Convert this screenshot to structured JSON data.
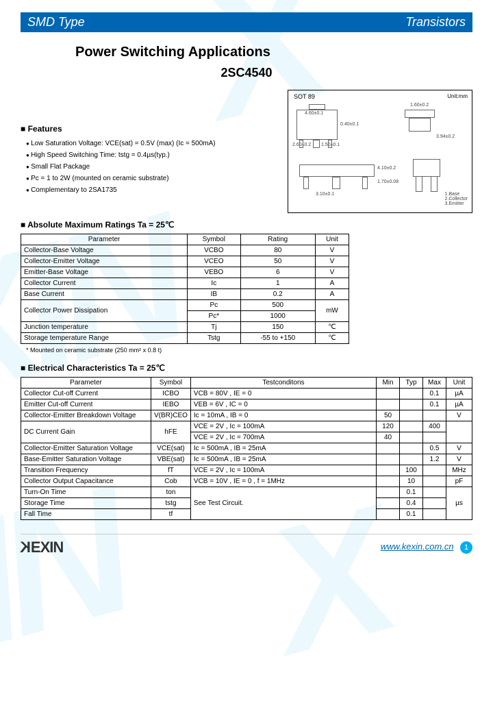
{
  "header": {
    "left": "SMD Type",
    "right": "Transistors"
  },
  "title1": "Power Switching Applications",
  "title2": "2SC4540",
  "features": {
    "heading": "Features",
    "items": [
      "Low Saturation Voltage: VCE(sat) = 0.5V (max) (Ic = 500mA)",
      "High Speed Switching Time: tstg = 0.4µs(typ.)",
      "Small Flat Package",
      "Pc = 1 to 2W (mounted on ceramic substrate)",
      "Complementary to 2SA1735"
    ]
  },
  "diagram": {
    "pkg": "SOT 89",
    "unit": "Unit:mm",
    "d1": "4.60±0.1",
    "d2": "1.50±0.1",
    "d3": "2.60±0.2",
    "d4": "0.40±0.1",
    "d5": "1.70±0.08",
    "d6": "4.10±0.2",
    "d7": "3.10±0.1",
    "d8": "0.40±0.1",
    "d9": "1.60±0.2",
    "d10": "3.94±0.2",
    "pins": "1.Base\n2.Collector\n3.Emitter"
  },
  "amr": {
    "heading": "Absolute Maximum Ratings Ta = 25℃",
    "head": [
      "Parameter",
      "Symbol",
      "Rating",
      "Unit"
    ],
    "rows": [
      [
        "Collector-Base Voltage",
        "VCBO",
        "80",
        "V"
      ],
      [
        "Collector-Emitter Voltage",
        "VCEO",
        "50",
        "V"
      ],
      [
        "Emitter-Base Voltage",
        "VEBO",
        "6",
        "V"
      ],
      [
        "Collector Current",
        "Ic",
        "1",
        "A"
      ],
      [
        "Base Current",
        "IB",
        "0.2",
        "A"
      ]
    ],
    "pdiss": {
      "param": "Collector Power Dissipation",
      "s1": "Pc",
      "v1": "500",
      "s2": "Pc*",
      "v2": "1000",
      "unit": "mW"
    },
    "rows2": [
      [
        "Junction temperature",
        "Tj",
        "150",
        "℃"
      ],
      [
        "Storage temperature Range",
        "Tstg",
        "-55 to +150",
        "℃"
      ]
    ],
    "note": "* Mounted on ceramic substrate (250 mm² x 0.8 t)"
  },
  "ec": {
    "heading": "Electrical Characteristics Ta = 25℃",
    "head": [
      "Parameter",
      "Symbol",
      "Testconditons",
      "Min",
      "Typ",
      "Max",
      "Unit"
    ],
    "rows": [
      [
        "Collector Cut-off Current",
        "ICBO",
        "VCB = 80V , IE = 0",
        "",
        "",
        "0.1",
        "µA"
      ],
      [
        "Emitter Cut-off Current",
        "IEBO",
        "VEB = 6V , IC = 0",
        "",
        "",
        "0.1",
        "µA"
      ],
      [
        "Collector-Emitter Breakdown Voltage",
        "V(BR)CEO",
        "Ic = 10mA , IB = 0",
        "50",
        "",
        "",
        "V"
      ]
    ],
    "dcgain": {
      "param": "DC Current Gain",
      "sym": "hFE",
      "c1": "VCE = 2V , Ic = 100mA",
      "mn1": "120",
      "mx1": "400",
      "c2": "VCE = 2V , Ic = 700mA",
      "mn2": "40"
    },
    "rows2": [
      [
        "Collector-Emitter Saturation Voltage",
        "VCE(sat)",
        "Ic = 500mA , IB = 25mA",
        "",
        "",
        "0.5",
        "V"
      ],
      [
        "Base-Emitter Saturation Voltage",
        "VBE(sat)",
        "Ic = 500mA , IB = 25mA",
        "",
        "",
        "1.2",
        "V"
      ],
      [
        "Transition Frequency",
        "fT",
        "VCE = 2V , Ic = 100mA",
        "",
        "100",
        "",
        "MHz"
      ],
      [
        "Collector Output Capacitance",
        "Cob",
        "VCB = 10V , IE = 0 , f = 1MHz",
        "",
        "10",
        "",
        "pF"
      ]
    ],
    "sw": {
      "cond": "See Test Circuit.",
      "unit": "µs",
      "r": [
        [
          "Turn-On Time",
          "ton",
          "0.1"
        ],
        [
          "Storage Time",
          "tstg",
          "0.4"
        ],
        [
          "Fall Time",
          "tf",
          "0.1"
        ]
      ]
    }
  },
  "footer": {
    "logo": "KEXIN",
    "url": "www.kexin.com.cn",
    "page": "1"
  }
}
